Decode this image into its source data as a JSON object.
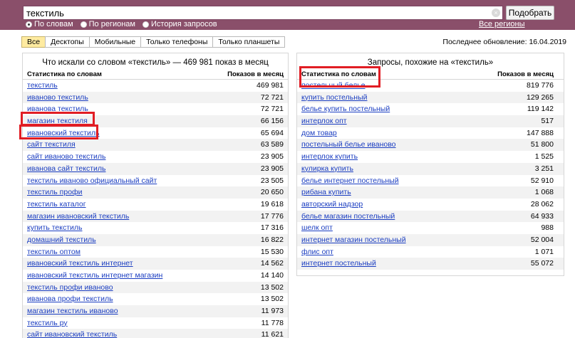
{
  "search": {
    "query": "текстиль",
    "submit_label": "Подобрать",
    "clear_glyph": "×"
  },
  "modes": [
    {
      "label": "По словам",
      "selected": true
    },
    {
      "label": "По регионам",
      "selected": false
    },
    {
      "label": "История запросов",
      "selected": false
    }
  ],
  "regions_link": "Все регионы",
  "tabs": [
    {
      "label": "Все",
      "active": true
    },
    {
      "label": "Десктопы",
      "active": false
    },
    {
      "label": "Мобильные",
      "active": false
    },
    {
      "label": "Только телефоны",
      "active": false
    },
    {
      "label": "Только планшеты",
      "active": false
    }
  ],
  "last_update": "Последнее обновление: 16.04.2019",
  "left_panel": {
    "title": "Что искали со словом «текстиль» — 469 981 показ в месяц",
    "col_words": "Статистика по словам",
    "col_shows": "Показов в месяц",
    "rows": [
      {
        "phrase": "текстиль",
        "count": "469 981"
      },
      {
        "phrase": "иваново текстиль",
        "count": "72 721"
      },
      {
        "phrase": "иванова текстиль",
        "count": "72 721"
      },
      {
        "phrase": "магазин текстиля",
        "count": "66 156"
      },
      {
        "phrase": "ивановский текстиль",
        "count": "65 694"
      },
      {
        "phrase": "сайт текстиля",
        "count": "63 589"
      },
      {
        "phrase": "сайт иваново текстиль",
        "count": "23 905"
      },
      {
        "phrase": "иванова сайт текстиль",
        "count": "23 905"
      },
      {
        "phrase": "текстиль иваново официальный сайт",
        "count": "23 505"
      },
      {
        "phrase": "текстиль профи",
        "count": "20 650"
      },
      {
        "phrase": "текстиль каталог",
        "count": "19 618"
      },
      {
        "phrase": "магазин ивановский текстиль",
        "count": "17 776"
      },
      {
        "phrase": "купить текстиль",
        "count": "17 316"
      },
      {
        "phrase": "домашний текстиль",
        "count": "16 822"
      },
      {
        "phrase": "текстиль оптом",
        "count": "15 530"
      },
      {
        "phrase": "ивановский текстиль интернет",
        "count": "14 562"
      },
      {
        "phrase": "ивановский текстиль интернет магазин",
        "count": "14 140"
      },
      {
        "phrase": "текстиль профи иваново",
        "count": "13 502"
      },
      {
        "phrase": "иванова профи текстиль",
        "count": "13 502"
      },
      {
        "phrase": "магазин текстиль иваново",
        "count": "11 973"
      },
      {
        "phrase": "текстиль ру",
        "count": "11 778"
      },
      {
        "phrase": "сайт ивановский текстиль",
        "count": "11 621"
      }
    ]
  },
  "right_panel": {
    "title": "Запросы, похожие на «текстиль»",
    "col_words": "Статистика по словам",
    "col_shows": "Показов в месяц",
    "rows": [
      {
        "phrase": "постельный белье",
        "count": "819 776"
      },
      {
        "phrase": "купить постельный",
        "count": "129 265"
      },
      {
        "phrase": "белье купить постельный",
        "count": "119 142"
      },
      {
        "phrase": "интерлок опт",
        "count": "517"
      },
      {
        "phrase": "дом товар",
        "count": "147 888"
      },
      {
        "phrase": "постельный белье иваново",
        "count": "51 800"
      },
      {
        "phrase": "интерлок купить",
        "count": "1 525"
      },
      {
        "phrase": "кулирка купить",
        "count": "3 251"
      },
      {
        "phrase": "белье интернет постельный",
        "count": "52 910"
      },
      {
        "phrase": "рибана купить",
        "count": "1 068"
      },
      {
        "phrase": "авторский надзор",
        "count": "28 062"
      },
      {
        "phrase": "белье магазин постельный",
        "count": "64 933"
      },
      {
        "phrase": "шелк опт",
        "count": "988"
      },
      {
        "phrase": "интернет магазин постельный",
        "count": "52 004"
      },
      {
        "phrase": "флис опт",
        "count": "1 071"
      },
      {
        "phrase": "интернет постельный",
        "count": "55 072"
      }
    ]
  },
  "colors": {
    "topbar": "#8a4f6a",
    "link": "#1a3dc1",
    "active_tab": "#ffeba0",
    "annotation": "#e11d24"
  }
}
